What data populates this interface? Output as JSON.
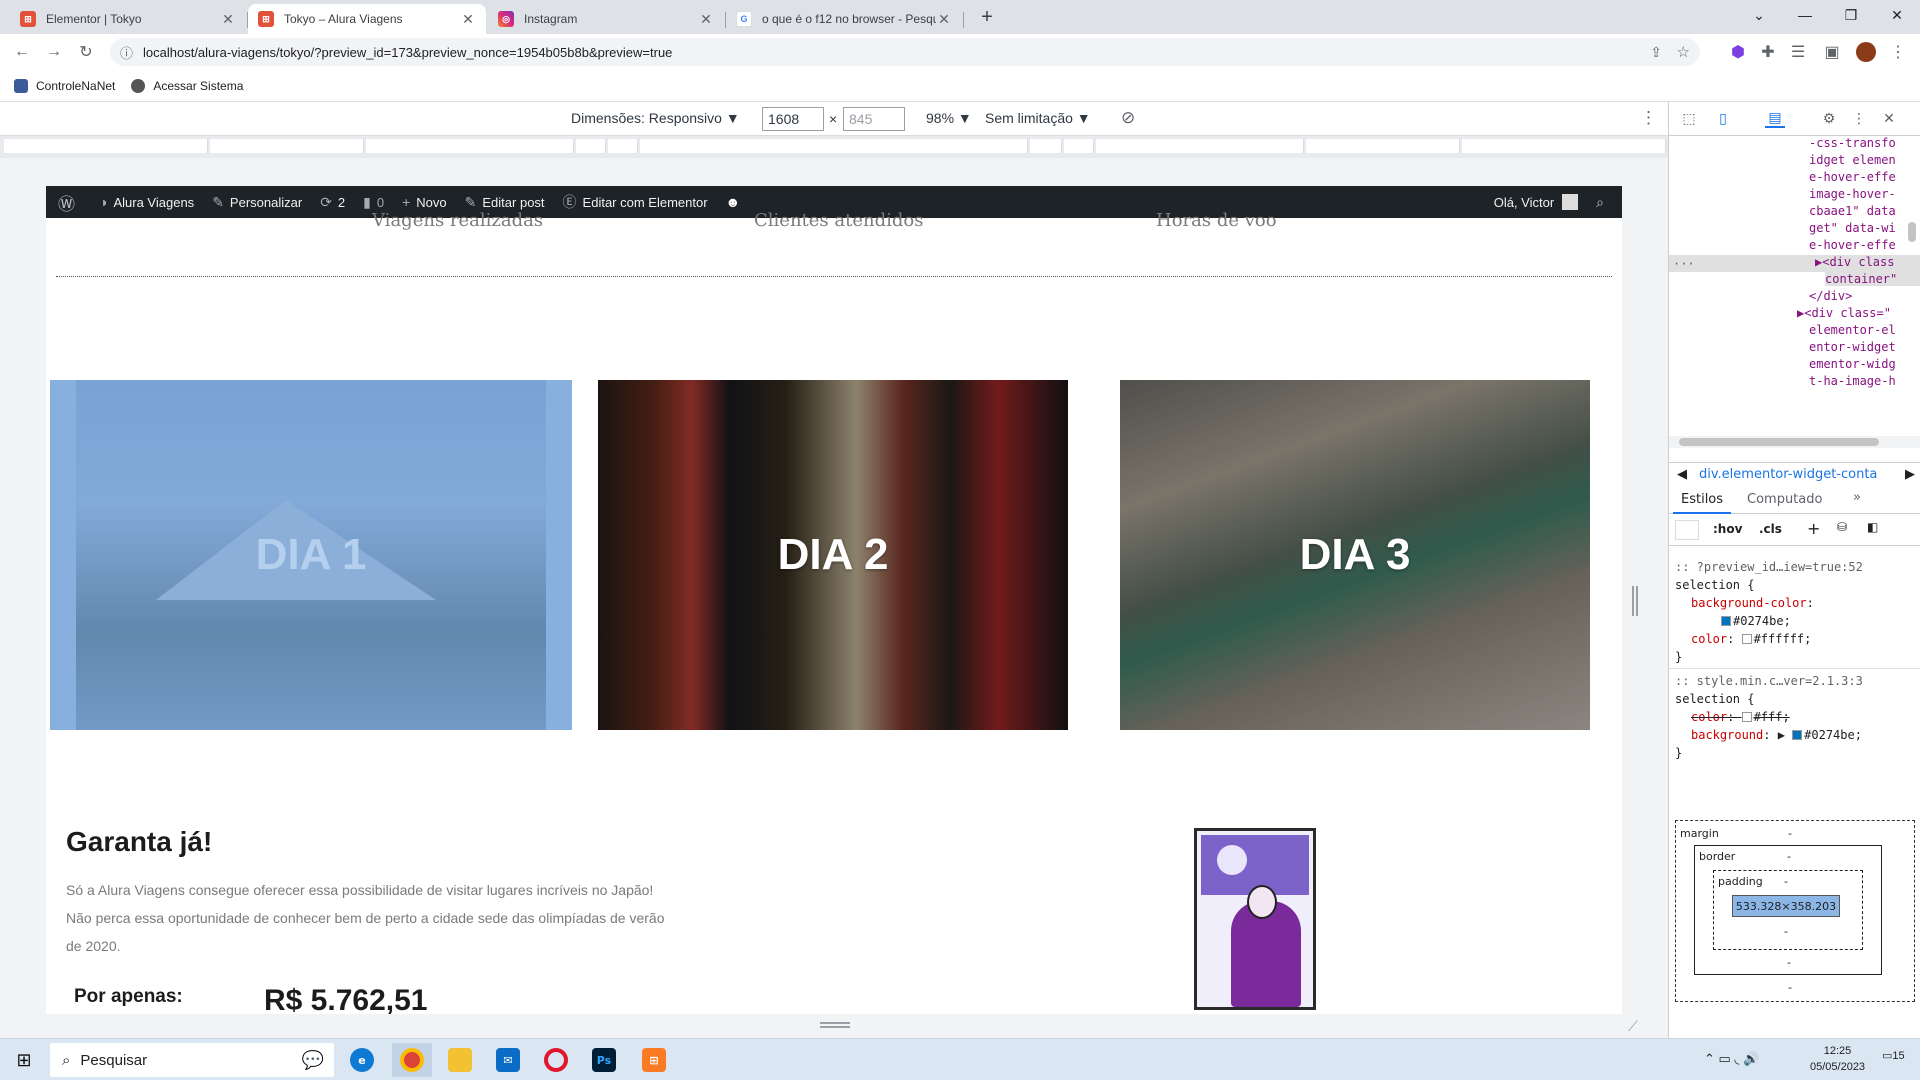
{
  "tabs": [
    {
      "title": "Elementor | Tokyo",
      "favicon_color": "#e2523a"
    },
    {
      "title": "Tokyo – Alura Viagens",
      "favicon_color": "#e2523a"
    },
    {
      "title": "Instagram",
      "favicon_color": "#d6249f"
    },
    {
      "title": "o que é o f12 no browser - Pesqui",
      "favicon_color": "#4285f4"
    }
  ],
  "toolbar": {
    "url": "localhost/alura-viagens/tokyo/?preview_id=173&preview_nonce=1954b05b8b&preview=true"
  },
  "bookmarks": [
    {
      "label": "ControleNaNet"
    },
    {
      "label": "Acessar Sistema"
    }
  ],
  "devbar": {
    "dimensions": "Dimensões: Responsivo ▼",
    "width": "1608",
    "times": "×",
    "height_placeholder": "845",
    "zoom": "98% ▼",
    "throttle": "Sem limitação ▼"
  },
  "wpbar": {
    "site_name": "Alura Viagens",
    "customize": "Personalizar",
    "updates": "2",
    "comments": "0",
    "new": "Novo",
    "edit_post": "Editar post",
    "edit_elementor": "Editar com Elementor",
    "greeting": "Olá, Victor"
  },
  "stats": [
    "Viagens realizadas",
    "Clientes atendidos",
    "Horas de voo"
  ],
  "cards": [
    {
      "label": "DIA 1"
    },
    {
      "label": "DIA 2"
    },
    {
      "label": "DIA 3"
    }
  ],
  "offer": {
    "title": "Garanta já!",
    "description": "Só a Alura Viagens consegue oferecer essa possibilidade de visitar lugares incríveis no Japão! Não perca essa oportunidade de conhecer bem de perto a cidade sede das olimpíadas de verão de 2020.",
    "price_label": "Por apenas:",
    "price": "R$ 5.762,51"
  },
  "devtools": {
    "elements": [
      "-css-transfo",
      "idget elemen",
      "e-hover-effe",
      "image-hover-",
      "cbaae1\" data",
      "get\" data-wi",
      "e-hover-effe",
      "▶<div class",
      "container\"",
      "</div>",
      "▶<div class=\"",
      "elementor-el",
      "entor-widget",
      "ementor-widg",
      "t-ha-image-h"
    ],
    "breadcrumb": "div.elementor-widget-conta",
    "tab_styles": "Estilos",
    "tab_computed": "Computado",
    "filter_hov": ":hov",
    "filter_cls": ".cls",
    "rule1_source": "::  ?preview_id…iew=true:52",
    "rule1_selector": "selection {",
    "rule1_prop1": "background-color",
    "rule1_val1": "#0274be;",
    "rule1_prop2": "color",
    "rule1_val2": "#ffffff;",
    "close_brace": "}",
    "rule2_source": "::  style.min.c…ver=2.1.3:3",
    "rule2_selector": "selection {",
    "rule2_prop1": "color",
    "rule2_val1": "#fff;",
    "rule2_prop2": "background",
    "rule2_val2": "#0274be;",
    "box_margin": "margin",
    "box_border": "border",
    "box_padding": "padding",
    "box_size": "533.328×358.203",
    "dash": "-",
    "color_blue": "#0274be",
    "color_white": "#ffffff"
  },
  "taskbar": {
    "search": "Pesquisar",
    "time": "12:25",
    "date": "05/05/2023",
    "notif": "15"
  }
}
